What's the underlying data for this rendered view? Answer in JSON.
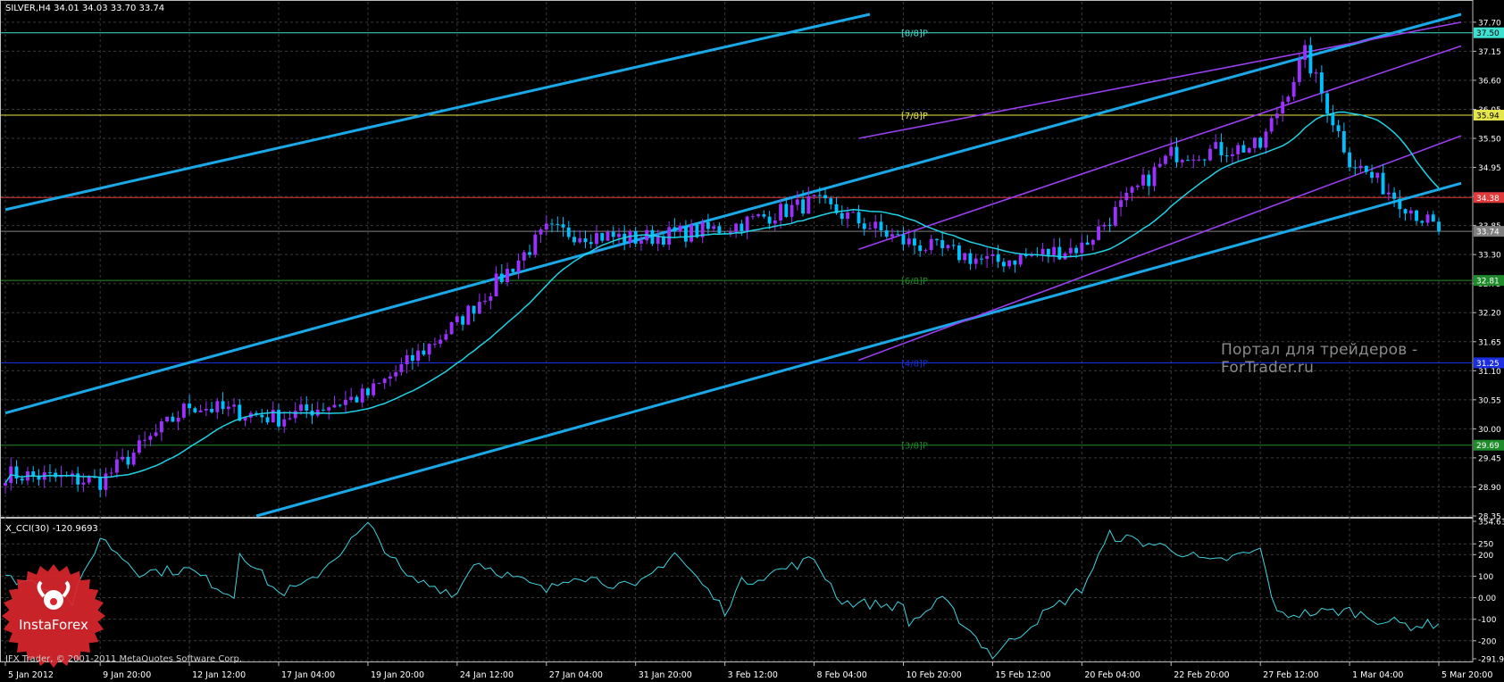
{
  "header": {
    "symbol_line": "SILVER,H4  34.01 34.03 33.70 33.74",
    "indicator_line": "X_CCI(30) -120.9693"
  },
  "watermark": "Портал для трейдеров - ForTrader.ru",
  "copyright": "IFX Trader, © 2001-2011 MetaQuotes Software Corp.",
  "logo": {
    "text": "InstaForex",
    "icon": "bull-seal-icon",
    "color": "#d9262c"
  },
  "colors": {
    "background": "#000000",
    "grid": "#3a3a3a",
    "bull_candle": "#9b30ff",
    "bear_candle": "#00bfff",
    "moving_average": "#1fd2e6",
    "regression_channel": "#1aa9e8",
    "std_channel": "#9a3ef0",
    "cci_line": "#3fd4e0",
    "level_8_8": "#40e0d0",
    "level_7_8": "#e6e64c",
    "level_6_8": "#1f8b2a",
    "level_4_8": "#1b2ee0",
    "level_2_8": "#1f8b2a",
    "red_level": "#e03a3a",
    "price_line": "#7f7f7f"
  },
  "chart_data": [
    {
      "type": "candlestick",
      "title": "SILVER,H4  34.01 34.03 33.70 33.74",
      "ylim": [
        28.35,
        37.85
      ],
      "y_ticks": [
        "37.70",
        "37.15",
        "36.60",
        "36.05",
        "35.50",
        "34.95",
        "34.40",
        "33.85",
        "33.30",
        "32.75",
        "32.20",
        "31.65",
        "31.10",
        "30.55",
        "30.00",
        "29.45",
        "28.90",
        "28.35"
      ],
      "x_ticks": [
        "5 Jan 2012",
        "9 Jan 20:00",
        "12 Jan 12:00",
        "17 Jan 04:00",
        "19 Jan 20:00",
        "24 Jan 12:00",
        "27 Jan 04:00",
        "31 Jan 20:00",
        "3 Feb 12:00",
        "8 Feb 04:00",
        "10 Feb 20:00",
        "15 Feb 12:00",
        "20 Feb 04:00",
        "22 Feb 20:00",
        "27 Feb 12:00",
        "1 Mar 04:00",
        "5 Mar 20:00"
      ],
      "grid": true,
      "close_anchors": [
        {
          "x": "5 Jan 2012",
          "close": 29.15
        },
        {
          "x": "9 Jan 20:00",
          "close": 29.0
        },
        {
          "x": "12 Jan 12:00",
          "close": 30.45
        },
        {
          "x": "17 Jan 04:00",
          "close": 30.2
        },
        {
          "x": "19 Jan 20:00",
          "close": 30.65
        },
        {
          "x": "24 Jan 12:00",
          "close": 32.0
        },
        {
          "x": "27 Jan 04:00",
          "close": 33.75
        },
        {
          "x": "31 Jan 20:00",
          "close": 33.6
        },
        {
          "x": "3 Feb 12:00",
          "close": 33.8
        },
        {
          "x": "8 Feb 04:00",
          "close": 34.3
        },
        {
          "x": "10 Feb 20:00",
          "close": 33.55
        },
        {
          "x": "15 Feb 12:00",
          "close": 33.15
        },
        {
          "x": "20 Feb 04:00",
          "close": 33.45
        },
        {
          "x": "22 Feb 20:00",
          "close": 35.2
        },
        {
          "x": "27 Feb 12:00",
          "close": 35.35
        },
        {
          "x": "28 Feb 20:00",
          "close": 37.1
        },
        {
          "x": "1 Mar 04:00",
          "close": 35.1
        },
        {
          "x": "5 Mar 20:00",
          "close": 33.74
        }
      ],
      "horizontal_levels": [
        {
          "value": 37.5,
          "label": "37.50",
          "tag": "[8/8]P",
          "color": "#40e0d0"
        },
        {
          "value": 35.94,
          "label": "35.94",
          "tag": "[7/8]P",
          "color": "#e6e64c"
        },
        {
          "value": 34.38,
          "label": "34.38",
          "tag": "",
          "color": "#e03a3a"
        },
        {
          "value": 33.74,
          "label": "33.74",
          "tag": "",
          "color": "#7f7f7f"
        },
        {
          "value": 32.81,
          "label": "32.81",
          "tag": "[6/8]P",
          "color": "#1f8b2a"
        },
        {
          "value": 31.25,
          "label": "31.25",
          "tag": "[4/8]P",
          "color": "#1b2ee0"
        },
        {
          "value": 29.69,
          "label": "29.69",
          "tag": "[3/8]P",
          "color": "#1f8b2a"
        }
      ],
      "channels": {
        "regression": [
          {
            "x0": "5 Jan 2012",
            "y0": 34.15,
            "x1": "9 Feb 20:00",
            "y1": 37.85
          },
          {
            "x0": "5 Jan 2012",
            "y0": 30.3,
            "x1": "6 Mar 12:00",
            "y1": 37.85
          },
          {
            "x0": "16 Jan 12:00",
            "y0": 28.35,
            "x1": "6 Mar 12:00",
            "y1": 34.65
          }
        ],
        "std": [
          {
            "x0": "9 Feb 12:00",
            "y0": 35.5,
            "x1": "6 Mar 12:00",
            "y1": 37.7
          },
          {
            "x0": "9 Feb 12:00",
            "y0": 33.4,
            "x1": "6 Mar 12:00",
            "y1": 37.25
          },
          {
            "x0": "9 Feb 12:00",
            "y0": 31.3,
            "x1": "6 Mar 12:00",
            "y1": 35.55
          }
        ]
      }
    },
    {
      "type": "line",
      "title": "X_CCI(30) -120.9693",
      "ylim": [
        -291.9678,
        354.631
      ],
      "y_ticks": [
        "354.631",
        "250",
        "200",
        "100",
        "0.00",
        "-100",
        "-200",
        "-291.967"
      ],
      "series": [
        {
          "points": [
            {
              "x": "5 Jan 2012",
              "y": 90
            },
            {
              "x": "6 Jan 2012",
              "y": 70
            },
            {
              "x": "8 Jan 2012",
              "y": -20
            },
            {
              "x": "9 Jan 20:00",
              "y": 280
            },
            {
              "x": "11 Jan 2012",
              "y": 120
            },
            {
              "x": "12 Jan 12:00",
              "y": 130
            },
            {
              "x": "14 Jan 2012",
              "y": -10
            },
            {
              "x": "16 Jan 2012",
              "y": 220
            },
            {
              "x": "17 Jan 04:00",
              "y": 20
            },
            {
              "x": "18 Jan 2012",
              "y": 60
            },
            {
              "x": "19 Jan 20:00",
              "y": 340
            },
            {
              "x": "21 Jan 2012",
              "y": 90
            },
            {
              "x": "24 Jan 12:00",
              "y": 20
            },
            {
              "x": "25 Jan 2012",
              "y": 170
            },
            {
              "x": "27 Jan 04:00",
              "y": 30
            },
            {
              "x": "30 Jan 2012",
              "y": 110
            },
            {
              "x": "31 Jan 20:00",
              "y": 40
            },
            {
              "x": "2 Feb 2012",
              "y": 210
            },
            {
              "x": "3 Feb 12:00",
              "y": -60
            },
            {
              "x": "5 Feb 2012",
              "y": 70
            },
            {
              "x": "8 Feb 04:00",
              "y": 180
            },
            {
              "x": "9 Feb 2012",
              "y": -20
            },
            {
              "x": "10 Feb 20:00",
              "y": -40
            },
            {
              "x": "12 Feb 2012",
              "y": -120
            },
            {
              "x": "14 Feb 2012",
              "y": -10
            },
            {
              "x": "15 Feb 12:00",
              "y": -270
            },
            {
              "x": "17 Feb 2012",
              "y": -80
            },
            {
              "x": "20 Feb 04:00",
              "y": 40
            },
            {
              "x": "21 Feb 2012",
              "y": 290
            },
            {
              "x": "22 Feb 20:00",
              "y": 230
            },
            {
              "x": "24 Feb 2012",
              "y": 160
            },
            {
              "x": "27 Feb 12:00",
              "y": 220
            },
            {
              "x": "28 Feb 2012",
              "y": -80
            },
            {
              "x": "1 Mar 04:00",
              "y": -60
            },
            {
              "x": "2 Mar 2012",
              "y": -100
            },
            {
              "x": "4 Mar 2012",
              "y": -130
            },
            {
              "x": "5 Mar 20:00",
              "y": -121
            }
          ]
        }
      ]
    }
  ]
}
